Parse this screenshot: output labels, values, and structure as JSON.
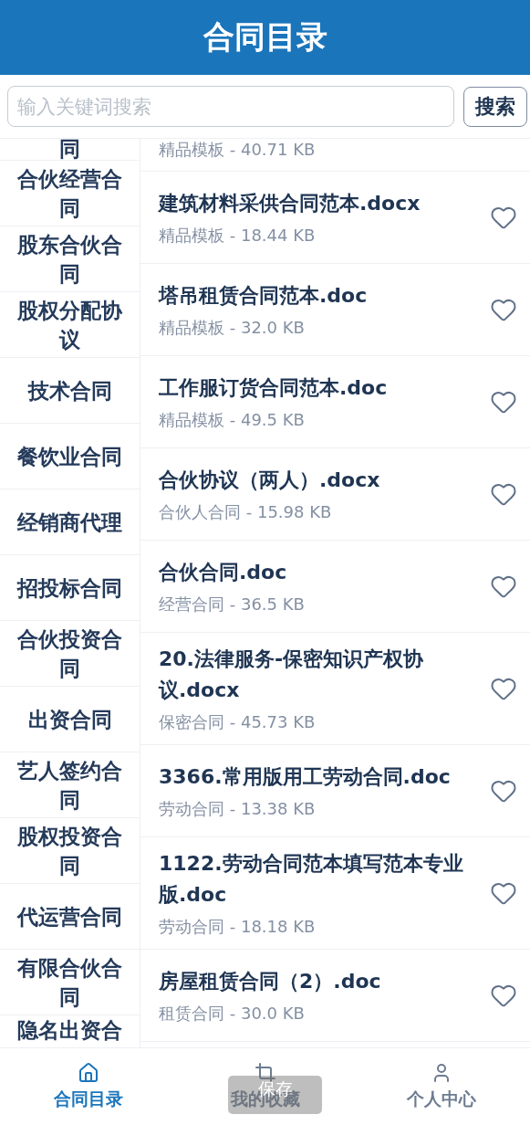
{
  "header": {
    "title": "合同目录"
  },
  "search": {
    "placeholder": "输入关键词搜索",
    "button": "搜索"
  },
  "categories": [
    {
      "label": "同",
      "kind": "partial-top"
    },
    {
      "label": "合伙经营合同",
      "kind": "full"
    },
    {
      "label": "股东合伙合同",
      "kind": "full"
    },
    {
      "label": "股权分配协议",
      "kind": "full"
    },
    {
      "label": "技术合同",
      "kind": "full"
    },
    {
      "label": "餐饮业合同",
      "kind": "full"
    },
    {
      "label": "经销商代理",
      "kind": "full"
    },
    {
      "label": "招投标合同",
      "kind": "full"
    },
    {
      "label": "合伙投资合同",
      "kind": "full"
    },
    {
      "label": "出资合同",
      "kind": "full"
    },
    {
      "label": "艺人签约合同",
      "kind": "full"
    },
    {
      "label": "股权投资合同",
      "kind": "full"
    },
    {
      "label": "代运营合同",
      "kind": "full"
    },
    {
      "label": "有限合伙合同",
      "kind": "full"
    },
    {
      "label": "隐名出资合",
      "kind": "partial-bottom"
    }
  ],
  "files": [
    {
      "kind": "partial-top",
      "meta": "精品模板 - 40.71 KB"
    },
    {
      "kind": "full",
      "name": "建筑材料采供合同范本.docx",
      "meta": "精品模板 - 18.44 KB",
      "favorite": false
    },
    {
      "kind": "full",
      "name": "塔吊租赁合同范本.doc",
      "meta": "精品模板 - 32.0 KB",
      "favorite": false
    },
    {
      "kind": "full",
      "name": "工作服订货合同范本.doc",
      "meta": "精品模板 - 49.5 KB",
      "favorite": false
    },
    {
      "kind": "full",
      "name": "合伙协议（两人）.docx",
      "meta": "合伙人合同 - 15.98 KB",
      "favorite": false
    },
    {
      "kind": "full",
      "name": "合伙合同.doc",
      "meta": "经营合同 - 36.5 KB",
      "favorite": false
    },
    {
      "kind": "full",
      "name": "20.法律服务-保密知识产权协议.docx",
      "meta": "保密合同 - 45.73 KB",
      "favorite": false
    },
    {
      "kind": "full",
      "name": "3366.常用版用工劳动合同.doc",
      "meta": "劳动合同 - 13.38 KB",
      "favorite": false
    },
    {
      "kind": "full",
      "name": "1122.劳动合同范本填写范本专业版.doc",
      "meta": "劳动合同 - 18.18 KB",
      "favorite": false
    },
    {
      "kind": "full",
      "name": "房屋租赁合同（2）.doc",
      "meta": "租赁合同 - 30.0 KB",
      "favorite": false
    }
  ],
  "tabs": [
    {
      "label": "合同目录",
      "selected": true
    },
    {
      "label": "我的收藏",
      "selected": false
    },
    {
      "label": "个人中心",
      "selected": false
    }
  ],
  "toast": "保存"
}
